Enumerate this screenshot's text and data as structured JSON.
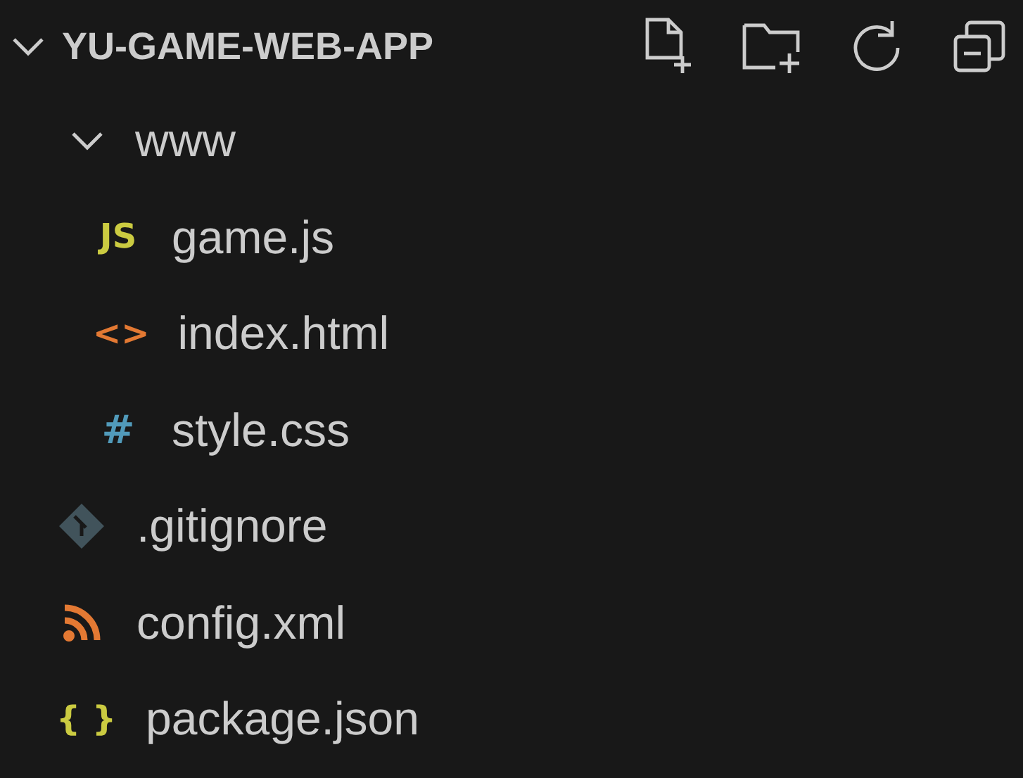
{
  "explorer": {
    "title": "YU-GAME-WEB-APP",
    "expanded": true
  },
  "tree": [
    {
      "name": "www",
      "kind": "folder",
      "expanded": true,
      "children": [
        {
          "name": "game.js",
          "kind": "glyph",
          "glyph": "JS",
          "color": "#cbcb41"
        },
        {
          "name": "index.html",
          "kind": "glyph",
          "glyph": "<>",
          "color": "#e37933"
        },
        {
          "name": "style.css",
          "kind": "glyph",
          "glyph": "#",
          "color": "#519aba"
        }
      ]
    },
    {
      "name": ".gitignore",
      "kind": "git",
      "color": "#41535b"
    },
    {
      "name": "config.xml",
      "kind": "feed",
      "color": "#e37933"
    },
    {
      "name": "package.json",
      "kind": "glyph",
      "glyph": "{ }",
      "color": "#cbcb41"
    }
  ]
}
